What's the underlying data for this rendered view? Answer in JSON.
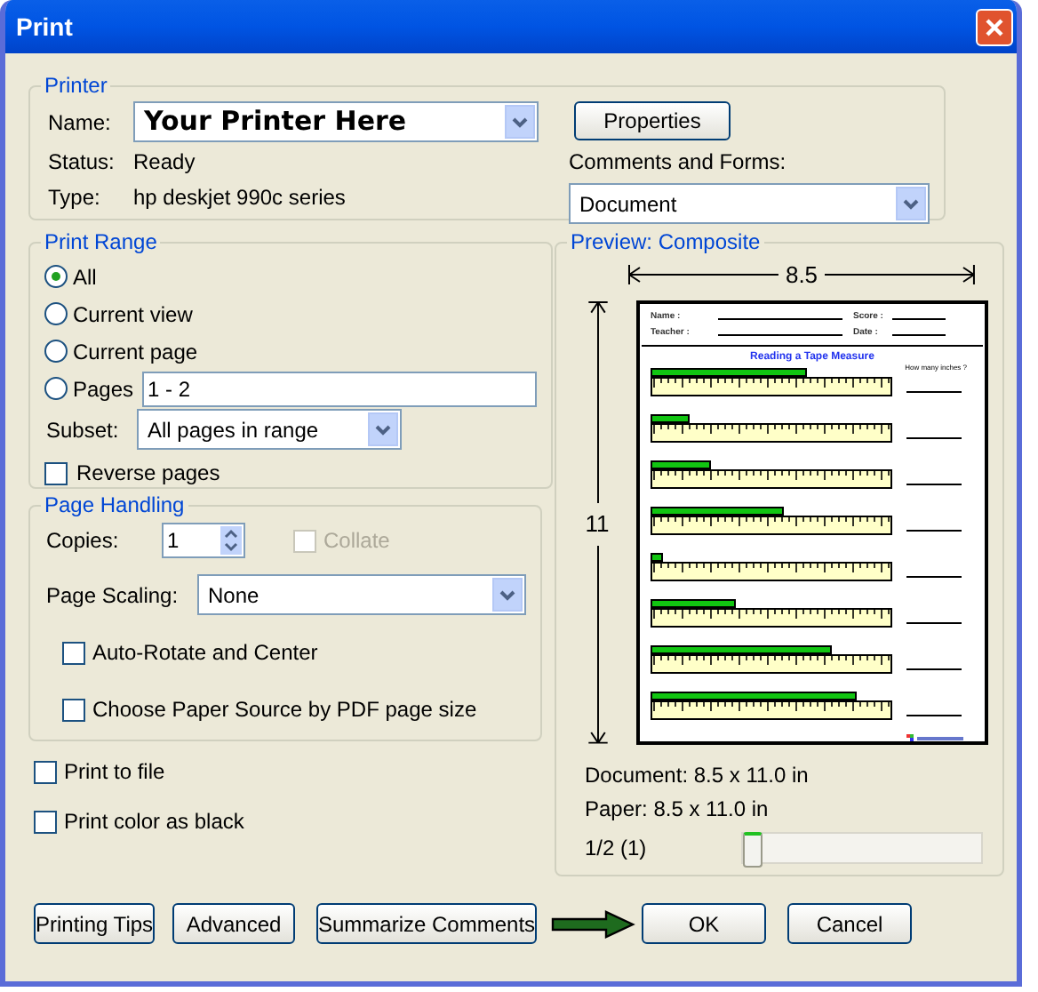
{
  "window": {
    "title": "Print"
  },
  "printer": {
    "legend": "Printer",
    "name_label": "Name:",
    "name_value": "Your Printer Here",
    "status_label": "Status:",
    "status": "Ready",
    "type_label": "Type:",
    "type": "hp deskjet 990c series",
    "properties_button": "Properties",
    "comments_label": "Comments and Forms:",
    "comments_value": "Document"
  },
  "print_range": {
    "legend": "Print Range",
    "options": [
      {
        "label": "All",
        "selected": true
      },
      {
        "label": "Current view",
        "selected": false
      },
      {
        "label": "Current page",
        "selected": false
      },
      {
        "label": "Pages",
        "selected": false
      }
    ],
    "pages_value": "1 - 2",
    "subset_label": "Subset:",
    "subset_value": "All pages in range",
    "reverse": {
      "label": "Reverse pages",
      "checked": false
    }
  },
  "page_handling": {
    "legend": "Page Handling",
    "copies_label": "Copies:",
    "copies_value": "1",
    "collate": {
      "label": "Collate",
      "checked": false,
      "disabled": true
    },
    "scaling_label": "Page Scaling:",
    "scaling_value": "None",
    "options": [
      {
        "label": "Auto-Rotate and Center",
        "checked": false
      },
      {
        "label": "Choose Paper Source by PDF page size",
        "checked": false
      }
    ]
  },
  "options": [
    {
      "label": "Print to file",
      "checked": false
    },
    {
      "label": "Print color as black",
      "checked": false
    }
  ],
  "preview": {
    "legend": "Preview: Composite",
    "width_label": "8.5",
    "height_label": "11",
    "page": {
      "fields": [
        {
          "label": "Name :"
        },
        {
          "label": "Score :"
        },
        {
          "label": "Teacher :"
        },
        {
          "label": "Date :"
        }
      ],
      "title": "Reading a Tape Measure",
      "question": "How many inches ?"
    },
    "document": "Document: 8.5 x 11.0 in",
    "paper": "Paper: 8.5 x 11.0 in",
    "page_count": "1/2 (1)",
    "slider": {
      "level": 0
    }
  },
  "buttons": [
    {
      "label": "Printing Tips",
      "pointed": false
    },
    {
      "label": "Advanced",
      "pointed": false
    },
    {
      "label": "Summarize Comments",
      "pointed": false
    },
    {
      "label": "OK",
      "pointed": true
    },
    {
      "label": "Cancel",
      "pointed": false
    }
  ]
}
